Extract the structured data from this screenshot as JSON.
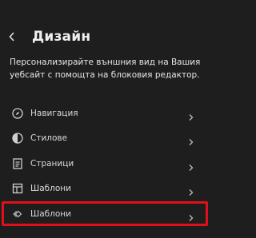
{
  "header": {
    "back_icon": "chevron-left-icon",
    "title": "Дизайн"
  },
  "description": "Персонализирайте външния вид на Вашия уебсайт с помощта на блоковия редактор.",
  "nav": {
    "items": [
      {
        "label": "Навигация",
        "icon": "compass-icon"
      },
      {
        "label": "Стилове",
        "icon": "half-circle-icon"
      },
      {
        "label": "Страници",
        "icon": "page-icon"
      },
      {
        "label": "Шаблони",
        "icon": "template-icon"
      },
      {
        "label": "Шаблони",
        "icon": "pattern-diamond-icon"
      }
    ],
    "chevron_icon": "chevron-right-icon"
  },
  "colors": {
    "background": "#1e1e1e",
    "text": "#e0e0e0",
    "highlight": "#e0101a"
  }
}
